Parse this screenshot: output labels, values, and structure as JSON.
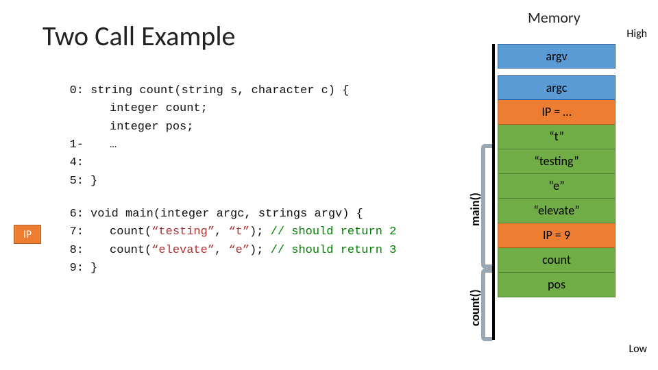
{
  "title": "Two Call Example",
  "memory_heading": "Memory",
  "high_label": "High",
  "low_label": "Low",
  "ip_badge": "IP",
  "code": {
    "l0_num": "0:",
    "l0_a": "string count(string s, character c) {",
    "l1_a": "integer count;",
    "l2_a": "integer pos;",
    "l14_num": "1-4:",
    "l14_a": "…",
    "l5_num": "5:",
    "l5_a": "}",
    "l6_num": "6:",
    "l6_a": "void main(integer argc, strings argv) {",
    "l7_num": "7:",
    "l7_a": "count(",
    "l7_s1": "“testing”",
    "l7_b": ", ",
    "l7_s2": "“t”",
    "l7_c": "); ",
    "l7_cm": "// should return 2",
    "l8_num": "8:",
    "l8_a": "count(",
    "l8_s1": "“elevate”",
    "l8_b": ", ",
    "l8_s2": "“e”",
    "l8_c": "); ",
    "l8_cm": "// should return 3",
    "l9_num": "9:",
    "l9_a": "}"
  },
  "stack": {
    "c0": "argv",
    "c1": "argc",
    "c2": "IP = …",
    "c3": "“t”",
    "c4": "“testing”",
    "c5": "“e”",
    "c6": "“elevate”",
    "c7": "IP = 9",
    "c8": "count",
    "c9": "pos"
  },
  "frames": {
    "main": "main()",
    "count": "count()"
  }
}
